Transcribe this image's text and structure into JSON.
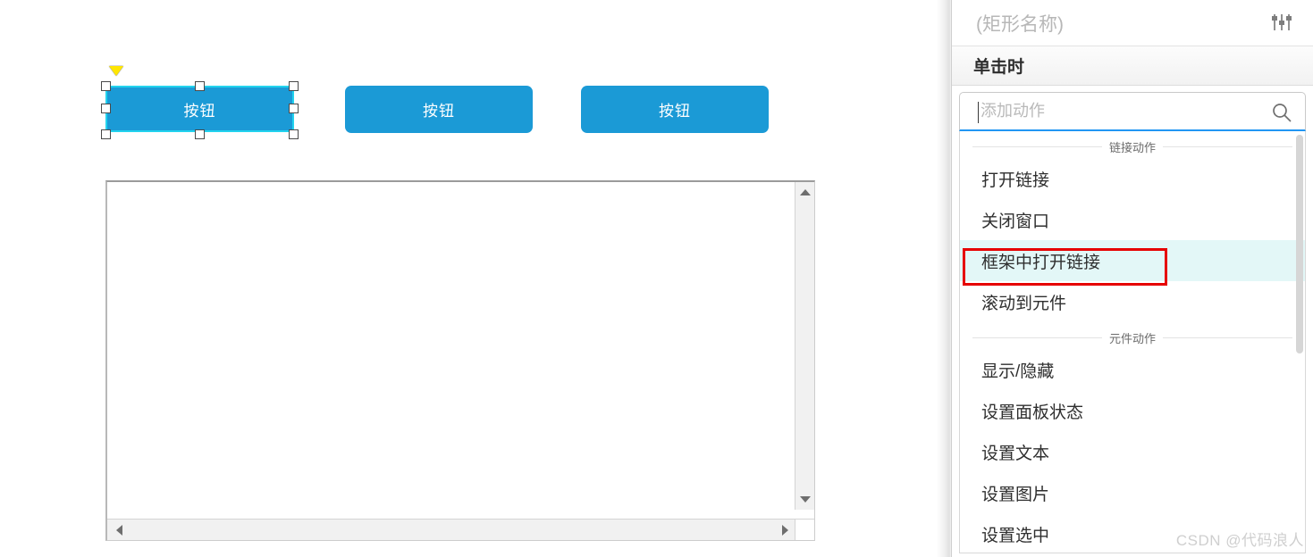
{
  "canvas": {
    "buttons": [
      {
        "label": "按钮",
        "selected": true
      },
      {
        "label": "按钮",
        "selected": false
      },
      {
        "label": "按钮",
        "selected": false
      }
    ],
    "button_color": "#1b9ad6",
    "selection_color": "#22d3ee",
    "marker_color": "#ffe600",
    "frame": {
      "name": "inline-frame",
      "h_scrollbar": true,
      "v_scrollbar": true
    }
  },
  "panel": {
    "title_placeholder": "(矩形名称)",
    "settings_icon": "sliders-icon",
    "event_header": "单击时",
    "search": {
      "placeholder": "添加动作",
      "value": "",
      "icon": "search-icon"
    },
    "sections": [
      {
        "label": "链接动作",
        "items": [
          {
            "label": "打开链接",
            "highlighted": false
          },
          {
            "label": "关闭窗口",
            "highlighted": false
          },
          {
            "label": "框架中打开链接",
            "highlighted": true
          },
          {
            "label": "滚动到元件",
            "highlighted": false
          }
        ]
      },
      {
        "label": "元件动作",
        "items": [
          {
            "label": "显示/隐藏",
            "highlighted": false
          },
          {
            "label": "设置面板状态",
            "highlighted": false
          },
          {
            "label": "设置文本",
            "highlighted": false
          },
          {
            "label": "设置图片",
            "highlighted": false
          },
          {
            "label": "设置选中",
            "highlighted": false
          }
        ]
      }
    ],
    "highlight_box_color": "#e60000",
    "highlight_row_color": "#e3f7f7"
  },
  "watermark": "CSDN @代码浪人"
}
